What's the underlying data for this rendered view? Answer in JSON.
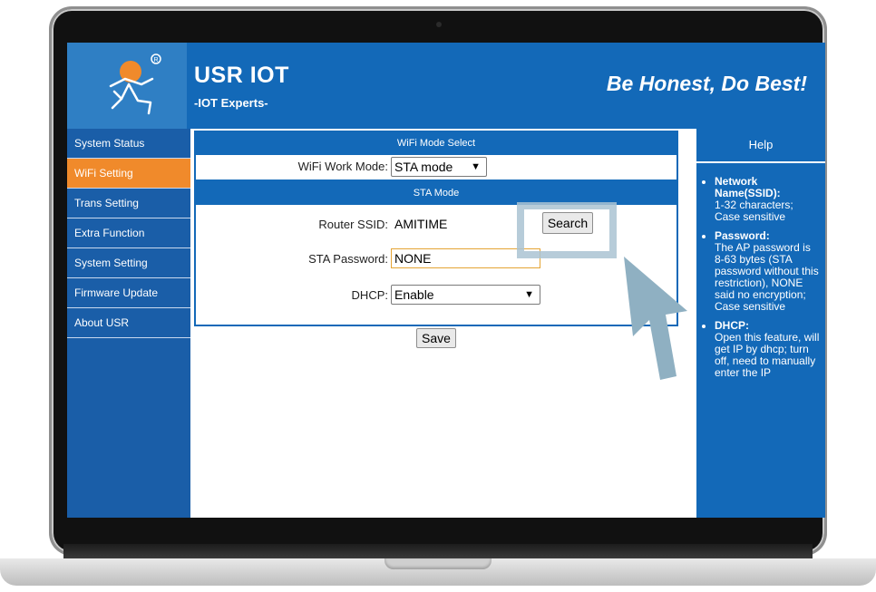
{
  "brand": {
    "title": "USR IOT",
    "subtitle": "-IOT Experts-",
    "slogan": "Be Honest, Do Best!"
  },
  "sidebar": {
    "items": [
      {
        "label": "System Status"
      },
      {
        "label": "WiFi Setting"
      },
      {
        "label": "Trans Setting"
      },
      {
        "label": "Extra Function"
      },
      {
        "label": "System Setting"
      },
      {
        "label": "Firmware Update"
      },
      {
        "label": "About USR"
      }
    ],
    "active_index": 1
  },
  "wifi_mode": {
    "header": "WiFi Mode Select",
    "label": "WiFi Work Mode:",
    "value": "STA mode"
  },
  "sta_mode": {
    "header": "STA Mode",
    "ssid_label": "Router SSID:",
    "ssid_value": "AMITIME",
    "search_label": "Search",
    "password_label": "STA Password:",
    "password_value": "NONE",
    "dhcp_label": "DHCP:",
    "dhcp_value": "Enable"
  },
  "actions": {
    "save_label": "Save"
  },
  "help": {
    "title": "Help",
    "items": [
      {
        "title": "Network Name(SSID):",
        "text": "1-32 characters; Case sensitive"
      },
      {
        "title": "Password:",
        "text": "The AP password is 8-63 bytes (STA password without this restriction), NONE said no encryption; Case sensitive"
      },
      {
        "title": "DHCP:",
        "text": "Open this feature, will get IP by dhcp; turn off, need to manually enter the IP"
      }
    ]
  },
  "colors": {
    "header_blue": "#1369b8",
    "active_orange": "#f08a2b",
    "highlight": "#aac3d2"
  },
  "icons": [
    "usr-logo-figure",
    "dropdown-caret-icon",
    "pointer-arrow-icon"
  ]
}
